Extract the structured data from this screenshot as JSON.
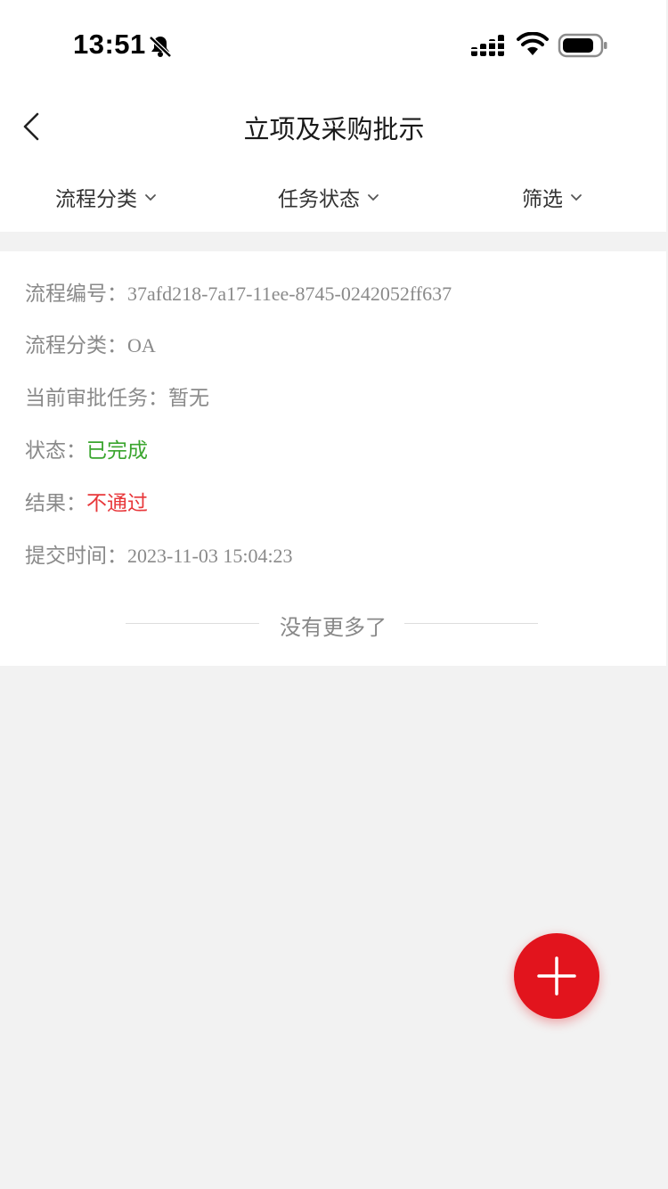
{
  "status_bar": {
    "time": "13:51",
    "icons": [
      "bell-slash-icon",
      "signal-icon",
      "wifi-icon",
      "battery-icon"
    ]
  },
  "nav": {
    "title": "立项及采购批示",
    "back_icon": "chevron-left-icon"
  },
  "filters": [
    {
      "label": "流程分类",
      "icon": "chevron-down-icon"
    },
    {
      "label": "任务状态",
      "icon": "chevron-down-icon"
    },
    {
      "label": "筛选",
      "icon": "chevron-down-icon"
    }
  ],
  "record": {
    "process_id_label": "流程编号：",
    "process_id": "37afd218-7a17-11ee-8745-0242052ff637",
    "category_label": "流程分类：",
    "category": "OA",
    "current_task_label": "当前审批任务：",
    "current_task": "暂无",
    "status_label": "状态：",
    "status": "已完成",
    "result_label": "结果：",
    "result": "不通过",
    "submit_time_label": "提交时间：",
    "submit_time": "2023-11-03 15:04:23"
  },
  "list_end_text": "没有更多了",
  "fab_icon": "plus-icon",
  "colors": {
    "status_green": "#3aa52e",
    "result_red": "#e8373a",
    "fab_red": "#e2141d",
    "page_bg": "#f2f2f2"
  }
}
